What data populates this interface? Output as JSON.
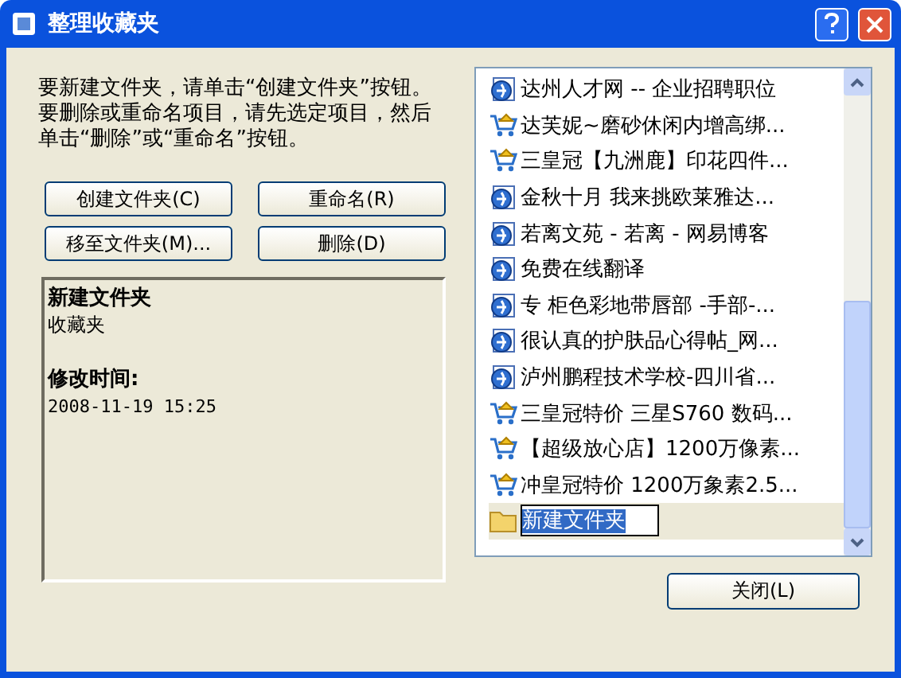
{
  "window": {
    "title": "整理收藏夹"
  },
  "instructions": "要新建文件夹，请单击“创建文件夹”按钮。要删除或重命名项目，请先选定项目，然后单击“删除”或“重命名”按钮。",
  "buttons": [
    "创建文件夹(C)",
    "重命名(R)",
    "移至文件夹(M)...",
    "删除(D)"
  ],
  "details": {
    "name": "新建文件夹",
    "type": "收藏夹",
    "modified_label": "修改时间:",
    "modified": "2008-11-19 15:25"
  },
  "favorites": [
    {
      "kind": "web",
      "label": "达州人才网 -- 企业招聘职位",
      "editing": false
    },
    {
      "kind": "shop",
      "label": "达芙妮~磨砂休闲内增高绑...",
      "editing": false
    },
    {
      "kind": "shop",
      "label": "三皇冠【九洲鹿】印花四件...",
      "editing": false
    },
    {
      "kind": "web",
      "label": "金秋十月 我来挑欧莱雅达...",
      "editing": false
    },
    {
      "kind": "web",
      "label": "若离文苑 - 若离 - 网易博客",
      "editing": false
    },
    {
      "kind": "web",
      "label": "免费在线翻译",
      "editing": false
    },
    {
      "kind": "web",
      "label": "专 柜色彩地带唇部 -手部-...",
      "editing": false
    },
    {
      "kind": "web",
      "label": "很认真的护肤品心得帖_网...",
      "editing": false
    },
    {
      "kind": "web",
      "label": "泸州鹏程技术学校-四川省...",
      "editing": false
    },
    {
      "kind": "shop",
      "label": "三皇冠特价 三星S760 数码...",
      "editing": false
    },
    {
      "kind": "shop",
      "label": "【超级放心店】1200万像素...",
      "editing": false
    },
    {
      "kind": "shop",
      "label": "冲皇冠特价 1200万象素2.5...",
      "editing": false
    },
    {
      "kind": "folder",
      "label": "新建文件夹",
      "editing": true
    }
  ],
  "close_button": "关闭(L)"
}
